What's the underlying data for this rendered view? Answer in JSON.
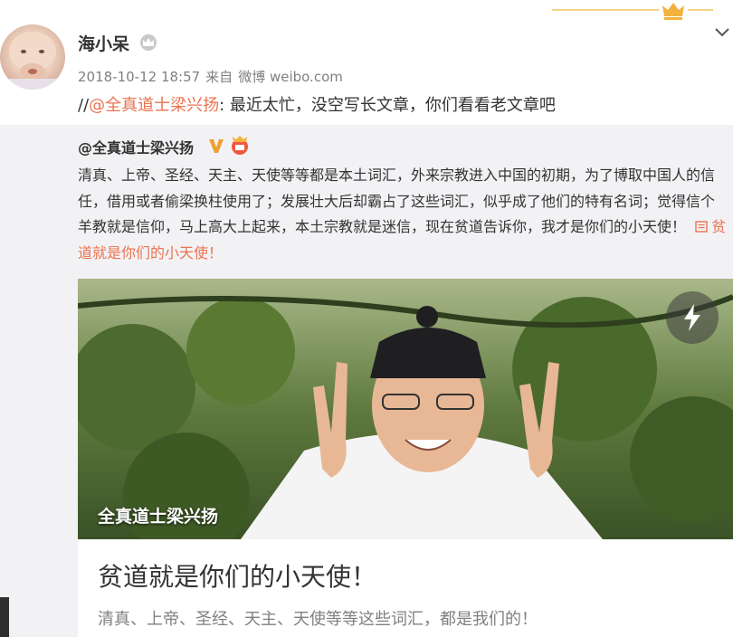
{
  "colors": {
    "accent": "#eb7350",
    "gold": "#f0a030",
    "repost_bg": "#f2f2f5",
    "meta": "#808080"
  },
  "icons": {
    "header": "crown-icon",
    "expand": "chevron-down-icon",
    "level": "crown-badge-icon",
    "verified": "verified-v-icon",
    "vip": "vip-crown-icon",
    "article": "article-link-icon",
    "flash": "lightning-icon"
  },
  "post": {
    "username": "海小呆",
    "time": "2018-10-12 18:57",
    "source_prefix": "来自",
    "source": "微博 weibo.com",
    "text_prefix": "//",
    "mention": "@全真道士梁兴扬",
    "text_body": ": 最近太忙，没空写长文章，你们看看老文章吧"
  },
  "repost": {
    "author": "@全真道士梁兴扬",
    "text": "清真、上帝、圣经、天主、天使等等都是本土词汇，外来宗教进入中国的初期，为了博取中国人的信任，借用或者偷梁换柱使用了；发展壮大后却霸占了这些词汇，似乎成了他们的特有名词；觉得信个羊教就是信仰，马上高大上起来，本土宗教就是迷信，现在贫道告诉你，我才是你们的小天使！",
    "link_text": "贫道就是你们的小天使！",
    "card": {
      "caption": "全真道士梁兴扬",
      "title": "贫道就是你们的小天使！",
      "summary": "清真、上帝、圣经、天主、天使等等这些词汇，都是我们的！"
    }
  }
}
